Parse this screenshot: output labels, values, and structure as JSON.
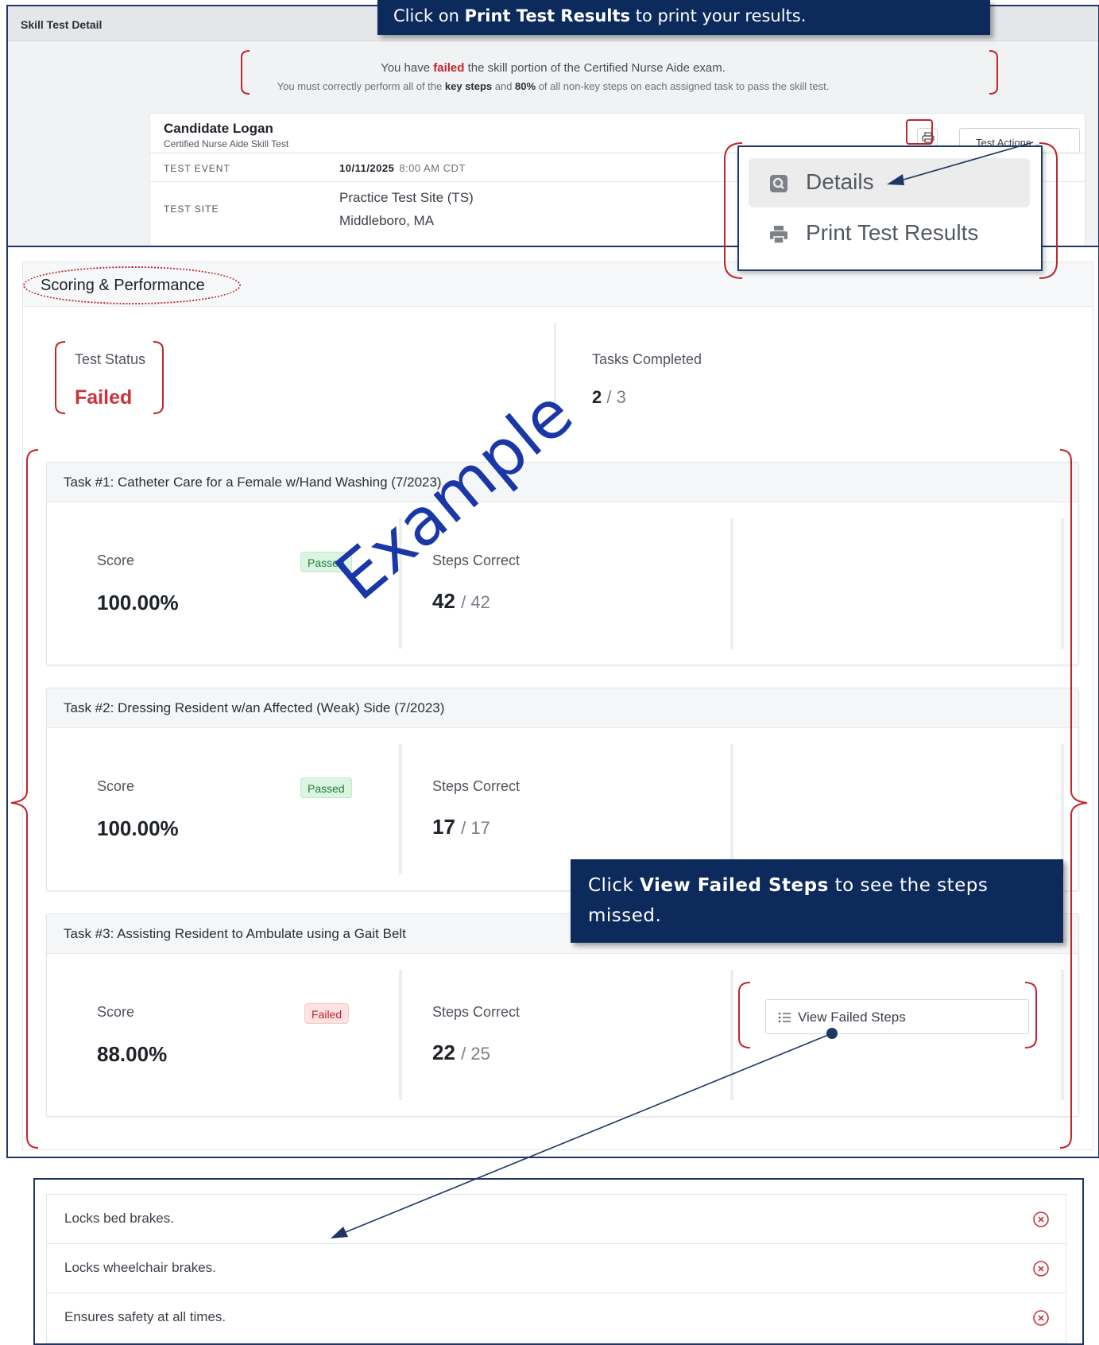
{
  "header": {
    "title": "Skill Test Detail"
  },
  "notice": {
    "line1_pre": "You have ",
    "line1_emph": "failed",
    "line1_post": " the skill portion of the Certified Nurse Aide exam.",
    "line2_pre": "You must correctly perform all of the ",
    "line2_b1": "key steps",
    "line2_mid": " and ",
    "line2_b2": "80%",
    "line2_post": " of all non-key steps on each assigned task to pass the skill test."
  },
  "candidate": {
    "name": "Candidate Logan",
    "subtitle": "Certified Nurse Aide Skill Test",
    "actions_label": "Test Actions",
    "test_event_label": "TEST EVENT",
    "test_event_date": "10/11/2025",
    "test_event_time": "8:00 AM CDT",
    "test_site_label": "TEST SITE",
    "test_site_name": "Practice Test Site (TS)",
    "test_site_location": "Middleboro, MA"
  },
  "dropdown": {
    "items": [
      {
        "label": "Details",
        "icon": "magnifier-doc-icon"
      },
      {
        "label": "Print Test Results",
        "icon": "printer-icon"
      }
    ]
  },
  "callouts": {
    "print_pre": "Click on ",
    "print_bold": "Print Test Results",
    "print_post": " to print your results.",
    "failed_pre": "Click ",
    "failed_bold": "View Failed Steps",
    "failed_post": " to see the steps missed."
  },
  "watermark": "Example",
  "performance": {
    "title": "Scoring & Performance",
    "test_status_label": "Test Status",
    "test_status_value": "Failed",
    "tasks_completed_label": "Tasks Completed",
    "tasks_completed": "2",
    "tasks_total": "/ 3"
  },
  "tasks": [
    {
      "title": "Task #1: Catheter Care for a Female w/Hand Washing (7/2023)",
      "score_label": "Score",
      "score": "100.00%",
      "badge": "Passed",
      "steps_label": "Steps Correct",
      "steps_correct": "42",
      "steps_total": "/ 42"
    },
    {
      "title": "Task #2: Dressing Resident w/an Affected (Weak) Side (7/2023)",
      "score_label": "Score",
      "score": "100.00%",
      "badge": "Passed",
      "steps_label": "Steps Correct",
      "steps_correct": "17",
      "steps_total": "/ 17"
    },
    {
      "title": "Task #3: Assisting Resident to Ambulate using a Gait Belt",
      "score_label": "Score",
      "score": "88.00%",
      "badge": "Failed",
      "steps_label": "Steps Correct",
      "steps_correct": "22",
      "steps_total": "/ 25",
      "action_label": "View Failed Steps"
    }
  ],
  "failed_steps": [
    "Locks bed brakes.",
    "Locks wheelchair brakes.",
    "Ensures safety at all times."
  ],
  "colors": {
    "callout_bg": "#0d2a5c",
    "failed_red": "#c9343a",
    "pass_green": "#1f7a38",
    "annotation_red": "#c0262d",
    "frame_navy": "#1f3766"
  }
}
